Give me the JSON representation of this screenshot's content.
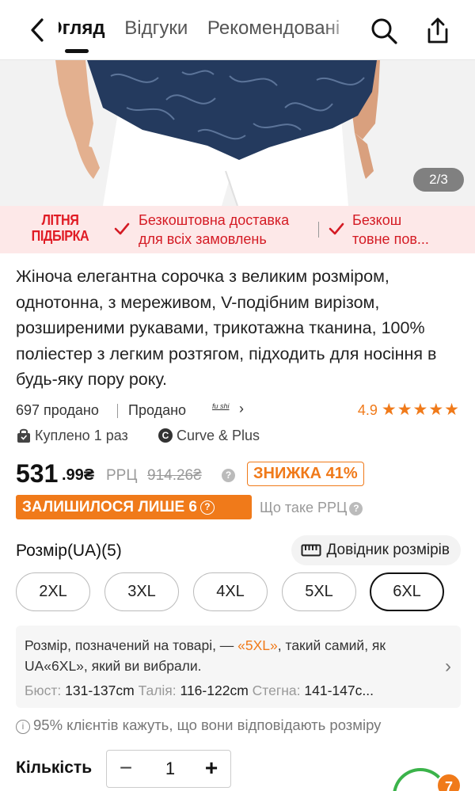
{
  "header": {
    "tabs": [
      {
        "label": "Огляд",
        "active": true
      },
      {
        "label": "Відгуки",
        "active": false
      },
      {
        "label": "Рекомендовані",
        "active": false
      }
    ],
    "icons": {
      "back": "chevron-left-icon",
      "search": "search-icon",
      "share": "share-icon"
    }
  },
  "gallery": {
    "counter": "2/3"
  },
  "promo": {
    "title_line1": "ЛІТНЯ",
    "title_line2": "ПІДБІРКА",
    "item1_line1": "Безкоштовна доставка",
    "item1_line2": "для всіх замовлень",
    "item2_line1": "Безкош",
    "item2_line2": "товне пов..."
  },
  "product": {
    "title": "Жіноча елегантна сорочка з великим розміром, однотонна, з мереживом, V-подібним вирізом, розширеними рукавами, трикотажна тканина, 100% поліестер з легким розтягом, підходить для носіння в будь-яку пору року.",
    "sold_count": "697 продано",
    "sold_by": "Продано",
    "seller_logo": "fu shi",
    "rating": "4.9",
    "stars": 5,
    "bought": "Куплено 1 раз",
    "brand_initial": "C",
    "brand": "Curve & Plus"
  },
  "price": {
    "main": "531",
    "cents": ".99₴",
    "rrp_label": "РРЦ",
    "rrp_value": "914.26₴",
    "discount": "ЗНИЖКА 41%",
    "stock": "ЗАЛИШИЛОСЯ ЛИШЕ 6",
    "rrp_question": "Що таке РРЦ"
  },
  "size": {
    "label": "Розмір(UA)(5)",
    "guide": "Довідник розмірів",
    "options": [
      "2XL",
      "3XL",
      "4XL",
      "5XL",
      "6XL"
    ],
    "selected": "6XL",
    "note_before": "Розмір, позначений на товарі, — ",
    "note_highlight": "«5XL»",
    "note_after": ", такий самий, як UA«6XL», який ви вибрали.",
    "bust_label": "Бюст:",
    "bust": "131-137cm",
    "waist_label": "Талія:",
    "waist": "116-122cm",
    "hips_label": "Стегна:",
    "hips": "141-147c..."
  },
  "fit": {
    "text": "95% клієнтів кажуть, що вони відповідають розміру"
  },
  "quantity": {
    "label": "Кількість",
    "value": "1",
    "minus": "−",
    "plus": "+"
  },
  "cart": {
    "badge": "7"
  },
  "colors": {
    "accent": "#f07a1a",
    "promo_red": "#e01b24",
    "promo_bg": "#fde8e8",
    "cart_green": "#3bb34a"
  }
}
